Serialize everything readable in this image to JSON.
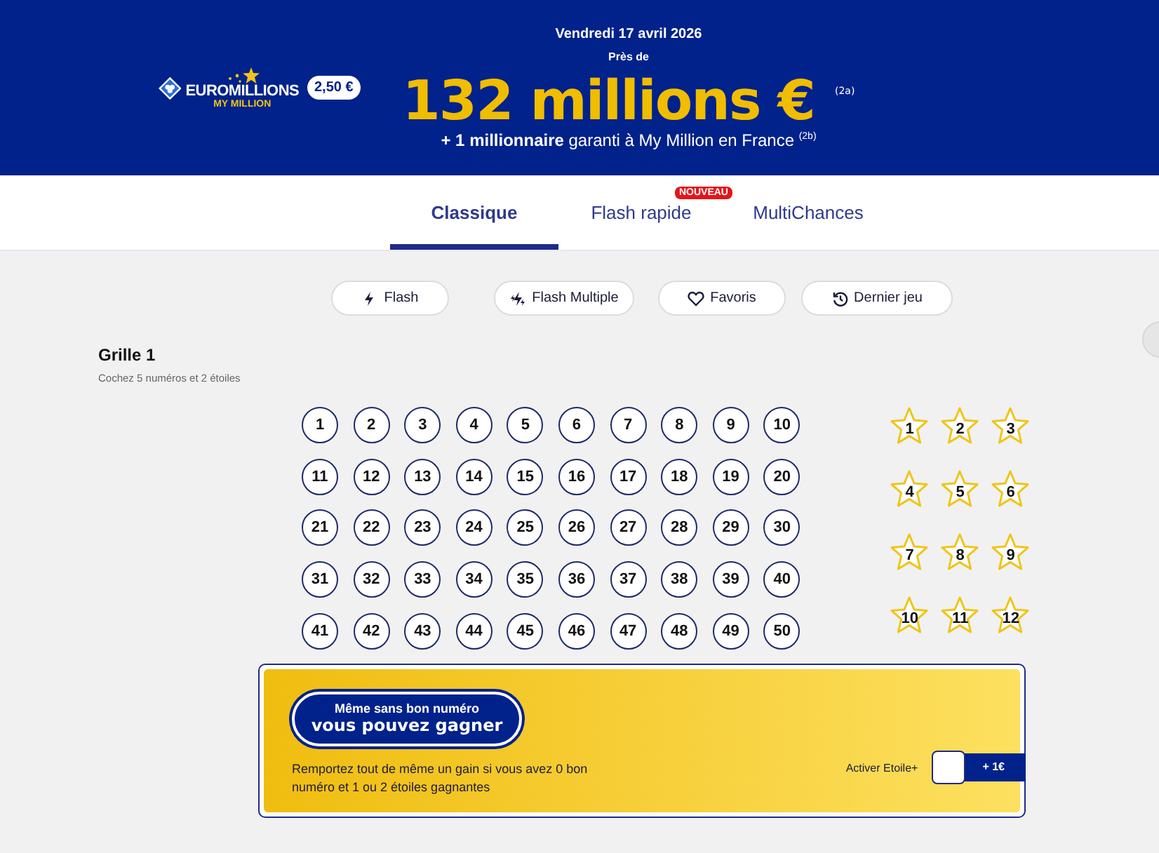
{
  "header": {
    "logo": {
      "name": "EUROMILLIONS",
      "subtitle": "MY MILLION"
    },
    "price": "2,50 €",
    "date": "Vendredi 17 avril 2026",
    "jackpot_prefix": "Près de",
    "jackpot": "132 millions € $^{(2a)}$",
    "bonus": "**+ 1 millionnaire** garanti à My Million en France $^{(2b)}$"
  },
  "tabs": [
    {
      "label": "Classique",
      "selected": true
    },
    {
      "label": "Flash rapide",
      "selected": false,
      "badge": "NOUVEAU"
    },
    {
      "label": "MultiChances",
      "selected": false
    }
  ],
  "toolbar": [
    {
      "label": "Flash",
      "kind": "flash"
    },
    {
      "label": "Flash Multiple",
      "kind": "multi"
    },
    {
      "label": "Favoris",
      "kind": "heart"
    },
    {
      "label": "Dernier jeu",
      "kind": "history"
    }
  ],
  "grid": {
    "title": "Grille 1",
    "hint": "Cochez 5 numéros et 2 étoiles",
    "numbers": [
      {
        "label": "1",
        "selected": false
      },
      {
        "label": "2",
        "selected": false
      },
      {
        "label": "3",
        "selected": false
      },
      {
        "label": "4",
        "selected": false
      },
      {
        "label": "5",
        "selected": false
      },
      {
        "label": "6",
        "selected": false
      },
      {
        "label": "7",
        "selected": false
      },
      {
        "label": "8",
        "selected": false
      },
      {
        "label": "9",
        "selected": false
      },
      {
        "label": "10",
        "selected": false
      },
      {
        "label": "11",
        "selected": false
      },
      {
        "label": "12",
        "selected": false
      },
      {
        "label": "13",
        "selected": false
      },
      {
        "label": "14",
        "selected": false
      },
      {
        "label": "15",
        "selected": false
      },
      {
        "label": "16",
        "selected": false
      },
      {
        "label": "17",
        "selected": false
      },
      {
        "label": "18",
        "selected": false
      },
      {
        "label": "19",
        "selected": false
      },
      {
        "label": "20",
        "selected": false
      },
      {
        "label": "21",
        "selected": false
      },
      {
        "label": "22",
        "selected": false
      },
      {
        "label": "23",
        "selected": false
      },
      {
        "label": "24",
        "selected": false
      },
      {
        "label": "25",
        "selected": false
      },
      {
        "label": "26",
        "selected": false
      },
      {
        "label": "27",
        "selected": false
      },
      {
        "label": "28",
        "selected": false
      },
      {
        "label": "29",
        "selected": false
      },
      {
        "label": "30",
        "selected": false
      },
      {
        "label": "31",
        "selected": false
      },
      {
        "label": "32",
        "selected": false
      },
      {
        "label": "33",
        "selected": false
      },
      {
        "label": "34",
        "selected": false
      },
      {
        "label": "35",
        "selected": false
      },
      {
        "label": "36",
        "selected": false
      },
      {
        "label": "37",
        "selected": false
      },
      {
        "label": "38",
        "selected": false
      },
      {
        "label": "39",
        "selected": false
      },
      {
        "label": "40",
        "selected": false
      },
      {
        "label": "41",
        "selected": false
      },
      {
        "label": "42",
        "selected": false
      },
      {
        "label": "43",
        "selected": false
      },
      {
        "label": "44",
        "selected": false
      },
      {
        "label": "45",
        "selected": false
      },
      {
        "label": "46",
        "selected": false
      },
      {
        "label": "47",
        "selected": false
      },
      {
        "label": "48",
        "selected": false
      },
      {
        "label": "49",
        "selected": false
      },
      {
        "label": "50",
        "selected": false
      }
    ],
    "stars": [
      {
        "label": "1",
        "selected": false
      },
      {
        "label": "2",
        "selected": false
      },
      {
        "label": "3",
        "selected": false
      },
      {
        "label": "4",
        "selected": false
      },
      {
        "label": "5",
        "selected": false
      },
      {
        "label": "6",
        "selected": false
      },
      {
        "label": "7",
        "selected": false
      },
      {
        "label": "8",
        "selected": false
      },
      {
        "label": "9",
        "selected": false
      },
      {
        "label": "10",
        "selected": false
      },
      {
        "label": "11",
        "selected": false
      },
      {
        "label": "12",
        "selected": false
      }
    ]
  },
  "promo": {
    "badge_line1": "Même sans bon numéro",
    "badge_line2": "vous pouvez gagner",
    "text": "Remportez tout de même un gain si vous avez 0 bon numéro et 1 ou 2 étoiles gagnantes",
    "option_label": "Activer Etoile+",
    "checked": false,
    "price": "+ 1€"
  }
}
